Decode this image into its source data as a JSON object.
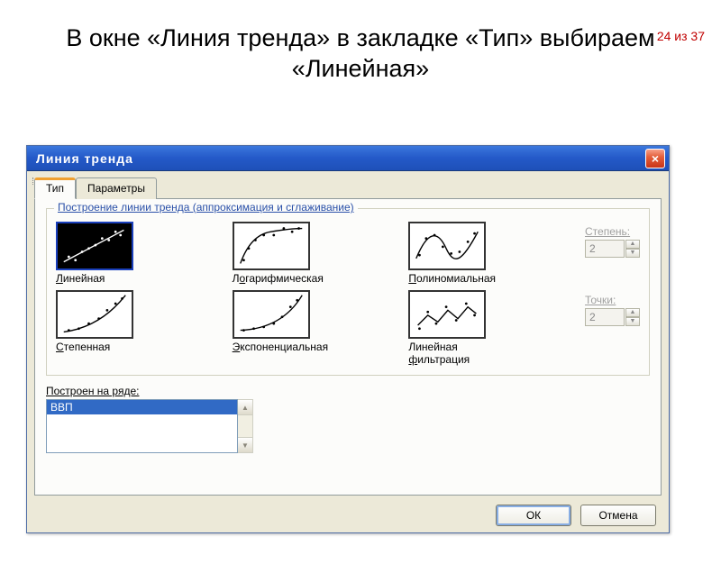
{
  "page_counter": "24 из 37",
  "slide_title": "В окне «Линия тренда» в закладке «Тип» выбираем «Линейная»",
  "dialog": {
    "title": "Линия тренда",
    "close_icon": "×",
    "tabs": {
      "type": "Тип",
      "params": "Параметры"
    },
    "group_legend": "Построение линии тренда (аппроксимация и сглаживание)",
    "trends": {
      "linear": {
        "pre": "",
        "ul": "Л",
        "post": "инейная"
      },
      "logarithmic": {
        "pre": "Л",
        "ul": "о",
        "post": "гарифмическая"
      },
      "polynomial": {
        "pre": "",
        "ul": "П",
        "post": "олиномиальная"
      },
      "power": {
        "pre": "",
        "ul": "С",
        "post": "тепенная"
      },
      "exponential": {
        "pre": "",
        "ul": "Э",
        "post": "кспоненциальная"
      },
      "movavg": {
        "pre": "Линейная ",
        "ul": "ф",
        "post": "ильтрация"
      }
    },
    "degree": {
      "label": "Степень:",
      "value": "2"
    },
    "points": {
      "label": "Точки:",
      "value": "2"
    },
    "series_label": "Построен на ряде:",
    "series_item": "ВВП",
    "buttons": {
      "ok": "ОК",
      "cancel": "Отмена"
    }
  }
}
